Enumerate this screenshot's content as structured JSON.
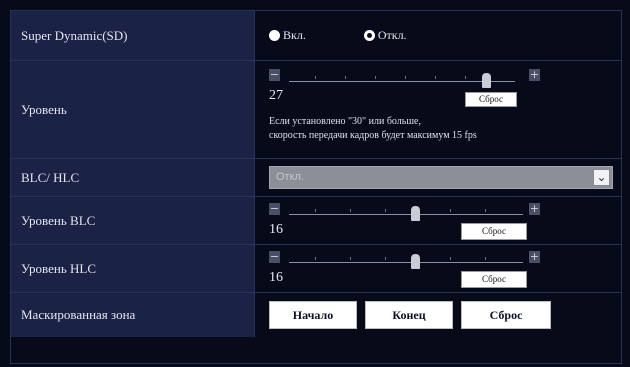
{
  "rows": {
    "super_dynamic": {
      "label": "Super Dynamic(SD)",
      "options": [
        "Вкл.",
        "Откл."
      ],
      "selected": "Откл."
    },
    "level": {
      "label": "Уровень",
      "value": "27",
      "minus": "−",
      "plus": "+",
      "reset": "Сброс",
      "note_line1": "Если установлено \"30\" или больше,",
      "note_line2": "скорость передачи кадров будет максимум 15 fps"
    },
    "blc_hlc": {
      "label": "BLC/ HLC",
      "selected_value": "Откл.",
      "arrow": "⌄"
    },
    "blc_level": {
      "label": "Уровень BLC",
      "value": "16",
      "minus": "−",
      "plus": "+",
      "reset": "Сброс"
    },
    "hlc_level": {
      "label": "Уровень HLC",
      "value": "16",
      "minus": "−",
      "plus": "+",
      "reset": "Сброс"
    },
    "mask_area": {
      "label": "Маскированная зона",
      "start": "Начало",
      "end": "Конец",
      "reset": "Сброс"
    }
  },
  "colors": {
    "label_bg": "#1a2245",
    "value_bg": "#070a18",
    "border": "#2a3158"
  }
}
